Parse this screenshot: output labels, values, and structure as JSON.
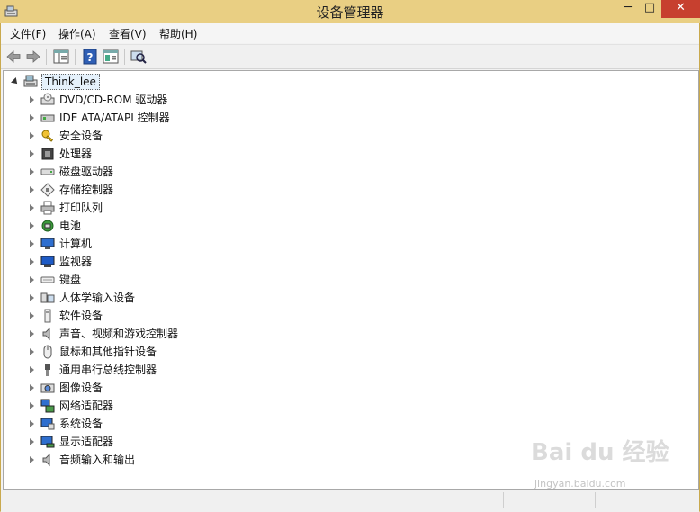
{
  "window": {
    "title": "设备管理器"
  },
  "menu": {
    "file": "文件(F)",
    "action": "操作(A)",
    "view": "查看(V)",
    "help": "帮助(H)"
  },
  "tree": {
    "root": "Think_lee",
    "items": [
      {
        "label": "DVD/CD-ROM 驱动器",
        "icon": "dvd-drive-icon"
      },
      {
        "label": "IDE ATA/ATAPI 控制器",
        "icon": "ide-controller-icon"
      },
      {
        "label": "安全设备",
        "icon": "security-key-icon"
      },
      {
        "label": "处理器",
        "icon": "processor-icon"
      },
      {
        "label": "磁盘驱动器",
        "icon": "disk-drive-icon"
      },
      {
        "label": "存储控制器",
        "icon": "storage-controller-icon"
      },
      {
        "label": "打印队列",
        "icon": "printer-icon"
      },
      {
        "label": "电池",
        "icon": "battery-icon"
      },
      {
        "label": "计算机",
        "icon": "computer-icon"
      },
      {
        "label": "监视器",
        "icon": "monitor-icon"
      },
      {
        "label": "键盘",
        "icon": "keyboard-icon"
      },
      {
        "label": "人体学输入设备",
        "icon": "hid-icon"
      },
      {
        "label": "软件设备",
        "icon": "software-device-icon"
      },
      {
        "label": "声音、视频和游戏控制器",
        "icon": "speaker-icon"
      },
      {
        "label": "鼠标和其他指针设备",
        "icon": "mouse-icon"
      },
      {
        "label": "通用串行总线控制器",
        "icon": "usb-icon"
      },
      {
        "label": "图像设备",
        "icon": "camera-icon"
      },
      {
        "label": "网络适配器",
        "icon": "network-adapter-icon"
      },
      {
        "label": "系统设备",
        "icon": "system-device-icon"
      },
      {
        "label": "显示适配器",
        "icon": "display-adapter-icon"
      },
      {
        "label": "音频输入和输出",
        "icon": "audio-io-icon"
      }
    ]
  },
  "watermark": {
    "brand": "Bai du 经验",
    "url": "jingyan.baidu.com"
  }
}
